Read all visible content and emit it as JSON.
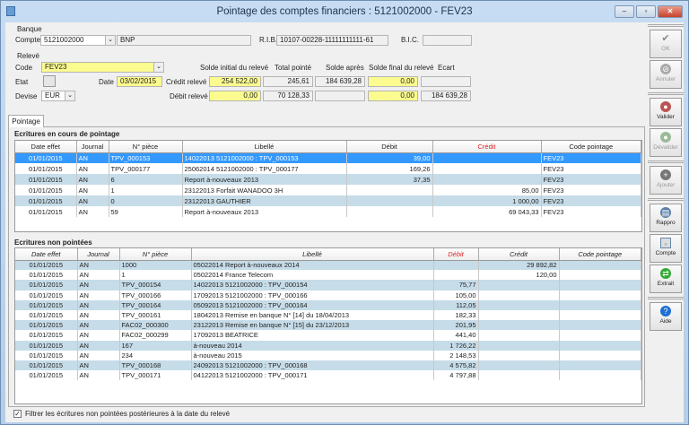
{
  "window": {
    "title": "Pointage des comptes financiers : 5121002000 - FEV23",
    "minimize": "–",
    "maximize": "▫",
    "close": "✕"
  },
  "banque": {
    "section": "Banque",
    "compte_label": "Compte",
    "compte": "5121002000",
    "bank_name": "BNP",
    "rib_label": "R.I.B.",
    "rib": "10107-00228-11111111111-61",
    "bic_label": "B.I.C.",
    "bic": ""
  },
  "releve": {
    "section": "Relevé",
    "code_label": "Code",
    "code": "FEV23",
    "etat_label": "Etat",
    "date_label": "Date",
    "date": "03/02/2015",
    "devise_label": "Devise",
    "devise": "EUR",
    "headers": {
      "solde_initial": "Solde initial du relevé",
      "total_pointe": "Total pointé",
      "solde_apres": "Solde après",
      "solde_final": "Solde final du relevé",
      "ecart": "Ecart"
    },
    "credit_label": "Crédit relevé",
    "debit_label": "Débit relevé",
    "credit": {
      "solde_initial": "254 522,00",
      "total_pointe": "245,61",
      "solde_apres": "184 639,28",
      "solde_final": "0,00",
      "ecart": ""
    },
    "debit": {
      "solde_initial": "0,00",
      "total_pointe": "70 128,33",
      "solde_apres": "",
      "solde_final": "0,00",
      "ecart": "184 639,28"
    }
  },
  "sidebar": {
    "ok": "OK",
    "annuler": "Annuler",
    "valider": "Valider",
    "devalider": "Dévalider",
    "ajouter": "Ajouter",
    "rappro": "Rappro",
    "compte": "Compte",
    "extrait": "Extrait",
    "aide": "Aide"
  },
  "tab": "Pointage",
  "en_cours": {
    "title": "Ecritures en cours de pointage",
    "columns": [
      "Date effet",
      "Journal",
      "N° pièce",
      "Libellé",
      "Débit",
      "Crédit",
      "Code pointage"
    ],
    "rows": [
      [
        "01/01/2015",
        "AN",
        "TPV_000153",
        "14022013 5121002000 : TPV_000153",
        "39,00",
        "",
        "FEV23"
      ],
      [
        "01/01/2015",
        "AN",
        "TPV_000177",
        "25062014 5121002000 : TPV_000177",
        "169,26",
        "",
        "FEV23"
      ],
      [
        "01/01/2015",
        "AN",
        "6",
        "Report à-nouveaux 2013",
        "37,35",
        "",
        "FEV23"
      ],
      [
        "01/01/2015",
        "AN",
        "1",
        "23122013 Forfait WANADOO 3H",
        "",
        "85,00",
        "FEV23"
      ],
      [
        "01/01/2015",
        "AN",
        "0",
        "23122013 GAUTHIER",
        "",
        "1 000,00",
        "FEV23"
      ],
      [
        "01/01/2015",
        "AN",
        "59",
        "Report à-nouveaux 2013",
        "",
        "69 043,33",
        "FEV23"
      ]
    ]
  },
  "non_pointees": {
    "title": "Ecritures non pointées",
    "columns": [
      "Date effet",
      "Journal",
      "N° pièce",
      "Libellé",
      "Débit",
      "Crédit",
      "Code pointage"
    ],
    "rows": [
      [
        "01/01/2015",
        "AN",
        "1000",
        "05022014 Report à-nouveaux 2014",
        "",
        "29 892,82",
        ""
      ],
      [
        "01/01/2015",
        "AN",
        "1",
        "05022014 France Telecom",
        "",
        "120,00",
        ""
      ],
      [
        "01/01/2015",
        "AN",
        "TPV_000154",
        "14022013 5121002000 : TPV_000154",
        "75,77",
        "",
        ""
      ],
      [
        "01/01/2015",
        "AN",
        "TPV_000166",
        "17092013 5121002000 : TPV_000166",
        "105,00",
        "",
        ""
      ],
      [
        "01/01/2015",
        "AN",
        "TPV_000164",
        "05092013 5121002000 : TPV_000164",
        "112,05",
        "",
        ""
      ],
      [
        "01/01/2015",
        "AN",
        "TPV_000161",
        "18042013 Remise en banque N° [14] du 18/04/2013",
        "182,33",
        "",
        ""
      ],
      [
        "01/01/2015",
        "AN",
        "FAC02_000300",
        "23122013 Remise en banque N° [15] du 23/12/2013",
        "201,95",
        "",
        ""
      ],
      [
        "01/01/2015",
        "AN",
        "FAC02_000299",
        "17092013 BEATRICE",
        "441,40",
        "",
        ""
      ],
      [
        "01/01/2015",
        "AN",
        "167",
        "à-nouveau 2014",
        "1 726,22",
        "",
        ""
      ],
      [
        "01/01/2015",
        "AN",
        "234",
        "à-nouveau 2015",
        "2 148,53",
        "",
        ""
      ],
      [
        "01/01/2015",
        "AN",
        "TPV_000168",
        "24092013 5121002000 : TPV_000168",
        "4 575,82",
        "",
        ""
      ],
      [
        "01/01/2015",
        "AN",
        "TPV_000171",
        "04122013 5121002000 : TPV_000171",
        "4 797,88",
        "",
        ""
      ]
    ]
  },
  "filter_label": "Filtrer les écritures non pointées postérieures à la date du relevé",
  "filter_checked": true
}
